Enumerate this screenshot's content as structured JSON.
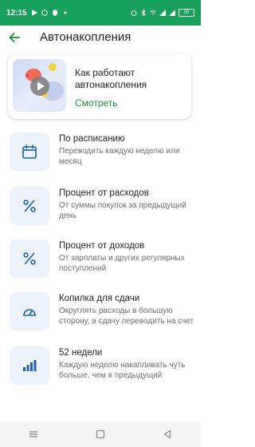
{
  "status": {
    "time": "12:15",
    "battery": "20"
  },
  "header": {
    "title": "Автонакопления"
  },
  "promo": {
    "line1": "Как работают",
    "line2": "автонакопления",
    "link": "Смотреть"
  },
  "items": [
    {
      "title": "По расписанию",
      "sub": "Переводить каждую неделю или месяц"
    },
    {
      "title": "Процент от расходов",
      "sub": "От суммы покупок за предыдущий день"
    },
    {
      "title": "Процент от доходов",
      "sub": "От зарплаты и других регулярных поступлений"
    },
    {
      "title": "Копилка для сдачи",
      "sub": "Округлять расходы в большую сторону, а сдачу переводить на счет"
    },
    {
      "title": "52 недели",
      "sub": "Каждую неделю накапливать чуть больше, чем в предыдущий"
    }
  ],
  "colors": {
    "accent": "#1b8e3a",
    "status_bar": "#18a15a",
    "icon": "#1f5fa8"
  }
}
